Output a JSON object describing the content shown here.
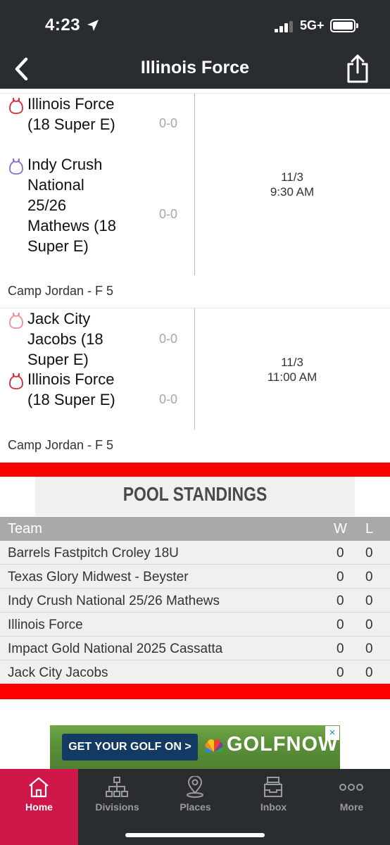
{
  "status": {
    "time": "4:23",
    "network": "5G+"
  },
  "nav": {
    "title": "Illinois Force"
  },
  "games": [
    {
      "home": {
        "name": "Illinois Force (18 Super E)",
        "score": "0-0",
        "icon_color": "#d9233a"
      },
      "away": {
        "name": "Indy Crush National 25/26 Mathews (18 Super E)",
        "score": "0-0",
        "icon_color": "#8b6cc7"
      },
      "date": "11/3",
      "time": "9:30 AM",
      "location": "Camp Jordan - F 5"
    },
    {
      "home": {
        "name": "Jack City Jacobs (18 Super E)",
        "score": "0-0",
        "icon_color": "#ef8b99"
      },
      "away": {
        "name": "Illinois Force (18 Super E)",
        "score": "0-0",
        "icon_color": "#d9233a"
      },
      "date": "11/3",
      "time": "11:00 AM",
      "location": "Camp Jordan - F 5"
    }
  ],
  "pool": {
    "title": "POOL STANDINGS",
    "columns": {
      "team": "Team",
      "w": "W",
      "l": "L"
    },
    "rows": [
      {
        "team": "Barrels Fastpitch Croley 18U",
        "w": "0",
        "l": "0"
      },
      {
        "team": "Texas Glory Midwest - Beyster",
        "w": "0",
        "l": "0"
      },
      {
        "team": "Indy Crush National 25/26 Mathews",
        "w": "0",
        "l": "0"
      },
      {
        "team": "Illinois Force",
        "w": "0",
        "l": "0"
      },
      {
        "team": "Impact Gold National 2025 Cassatta",
        "w": "0",
        "l": "0"
      },
      {
        "team": "Jack City Jacobs",
        "w": "0",
        "l": "0"
      }
    ]
  },
  "ad": {
    "button": "GET YOUR GOLF ON >",
    "brand": "GOLFNOW",
    "close": "×"
  },
  "tabs": [
    {
      "label": "Home",
      "icon": "home-icon",
      "active": true
    },
    {
      "label": "Divisions",
      "icon": "divisions-icon",
      "active": false
    },
    {
      "label": "Places",
      "icon": "location-pin-icon",
      "active": false
    },
    {
      "label": "Inbox",
      "icon": "inbox-icon",
      "active": false
    },
    {
      "label": "More",
      "icon": "more-dots-icon",
      "active": false
    }
  ],
  "colors": {
    "header": "#2a2d30",
    "accent_red": "#ff0000",
    "tab_active": "#d0174a"
  }
}
